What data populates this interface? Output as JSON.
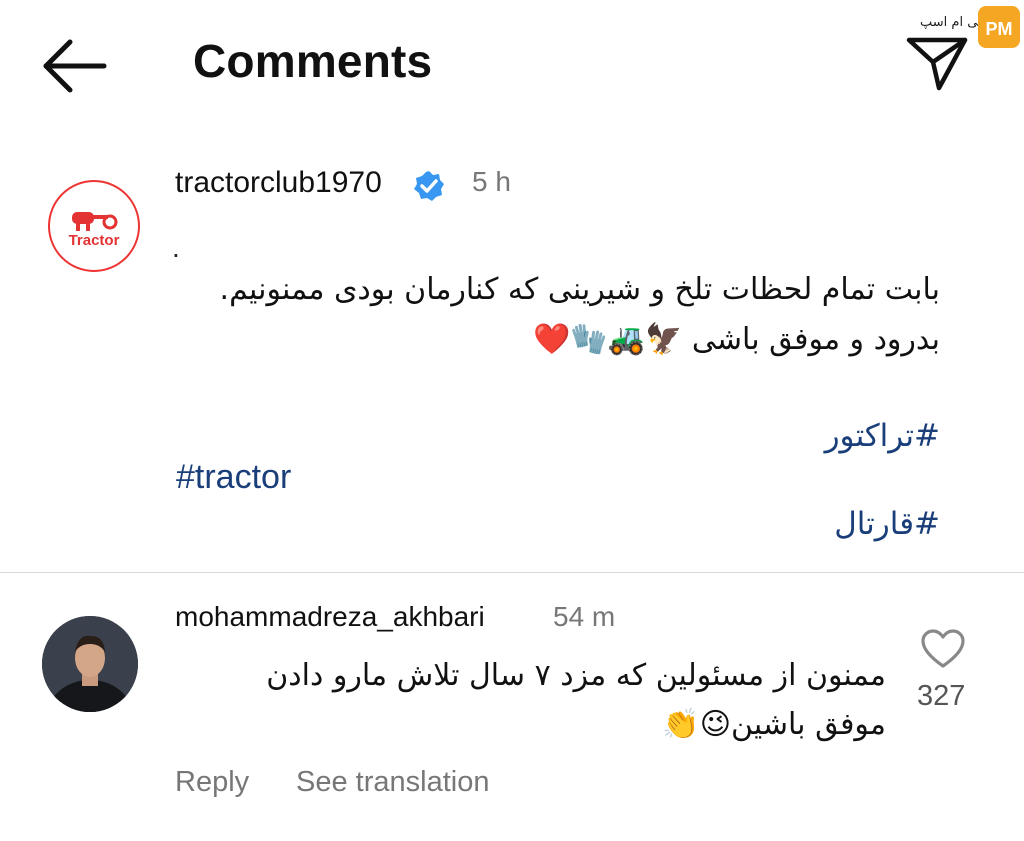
{
  "header": {
    "title": "Comments",
    "back_icon": "arrow-left-icon",
    "share_icon": "send-icon",
    "watermark_text": "پی ام اسپ",
    "watermark_logo": "PM"
  },
  "post": {
    "username": "tractorclub1970",
    "verified_icon": "verified-badge-icon",
    "time": "5 h",
    "avatar_text": "Tractor",
    "dot": ".",
    "line1": "بابت تمام لحظات تلخ و شیرینی که کنارمان بودی ممنونیم.",
    "line2_text": "بدرود و موفق باشی ",
    "line2_emojis": "🦅🚜🧤❤️",
    "hashtags": [
      "#تراکتور",
      "#tractor",
      "#قارتال"
    ]
  },
  "comment": {
    "username": "mohammadreza_akhbari",
    "time": "54 m",
    "line1": "ممنون از مسئولین که مزد ۷ سال تلاش مارو دادن",
    "line2_text": "موفق باشین",
    "line2_emojis": "😉👏",
    "likes": "327",
    "reply_label": "Reply",
    "translate_label": "See translation"
  },
  "colors": {
    "hashtag": "#1a3e7a",
    "verified": "#3897f0",
    "brand_red": "#e33333",
    "muted": "#777777"
  }
}
